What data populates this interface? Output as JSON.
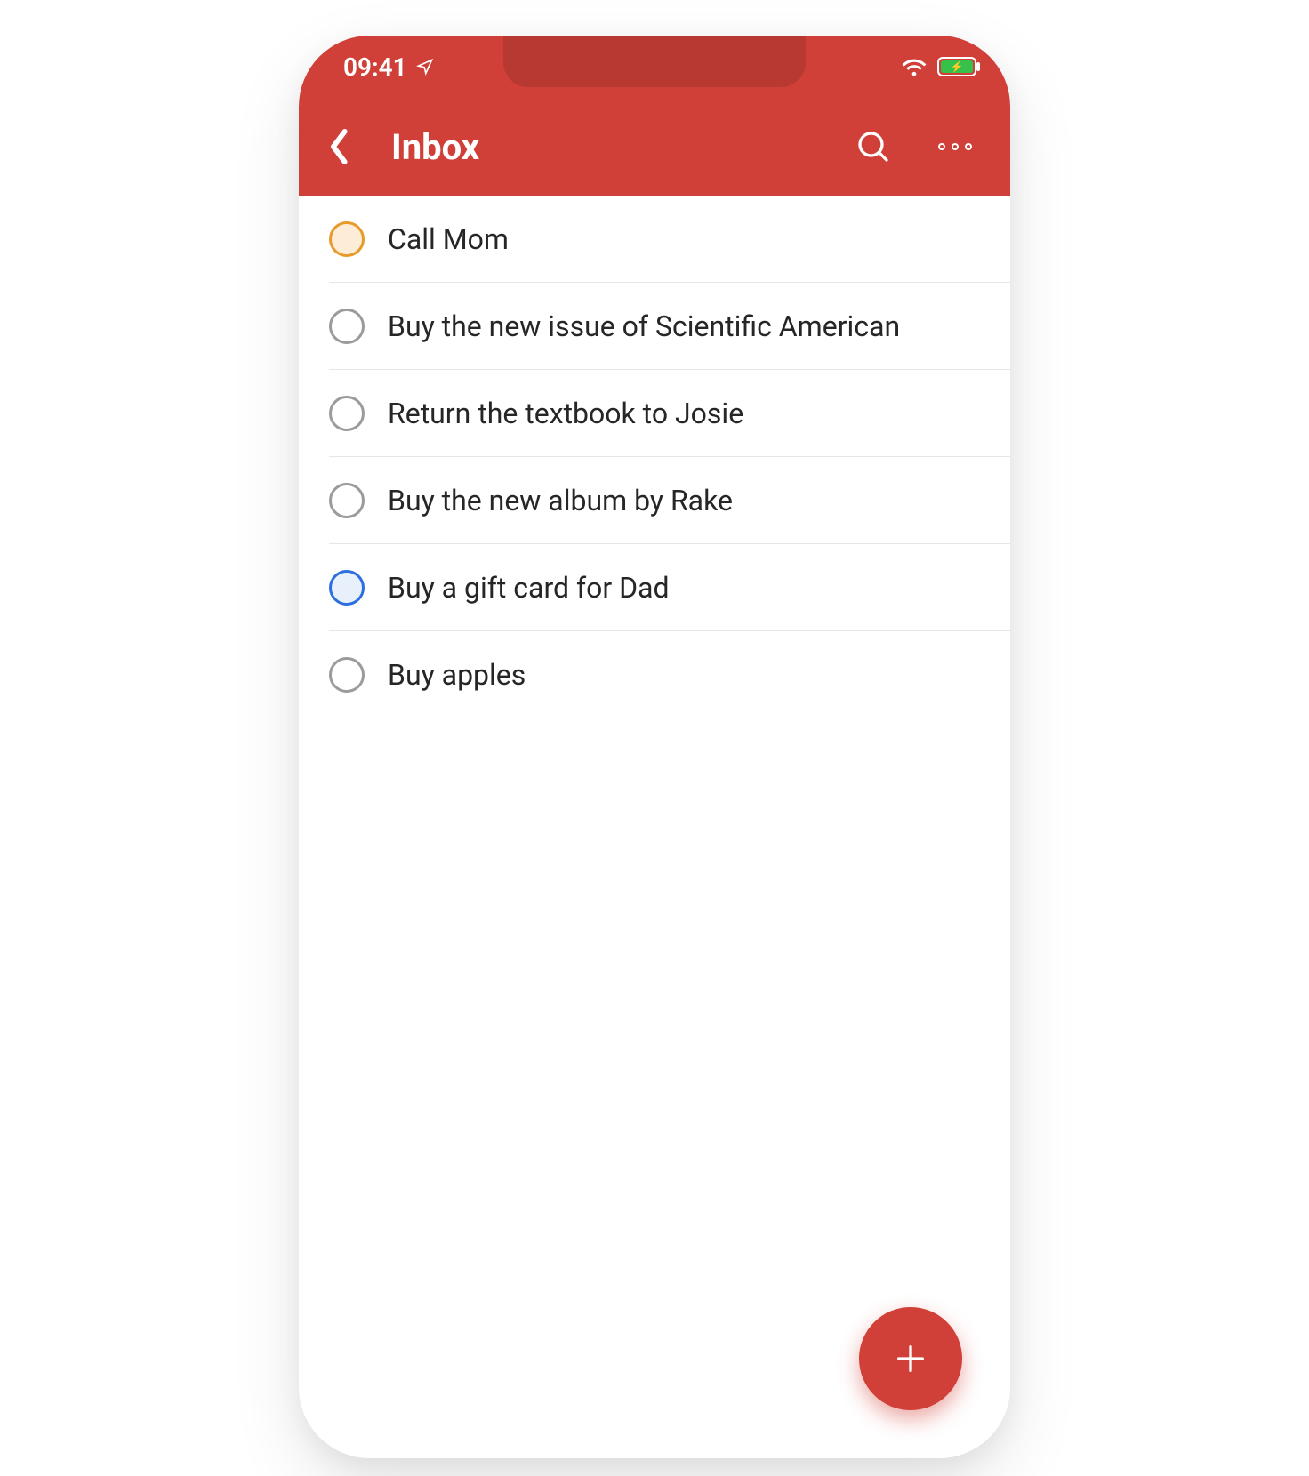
{
  "status": {
    "time": "09:41"
  },
  "nav": {
    "title": "Inbox"
  },
  "tasks": [
    {
      "title": "Call Mom",
      "priority": "orange"
    },
    {
      "title": "Buy the new issue of Scientific American",
      "priority": "none"
    },
    {
      "title": "Return the textbook to Josie",
      "priority": "none"
    },
    {
      "title": "Buy the new album by Rake",
      "priority": "none"
    },
    {
      "title": "Buy a gift card for Dad",
      "priority": "blue"
    },
    {
      "title": "Buy apples",
      "priority": "none"
    }
  ]
}
